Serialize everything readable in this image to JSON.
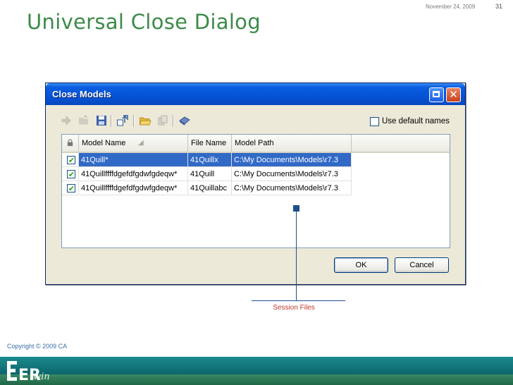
{
  "slide": {
    "date": "November 24, 2009",
    "page_number": "31",
    "title": "Universal Close Dialog",
    "copyright": "Copyright © 2009 CA",
    "logo_text": "ER",
    "logo_script": "win"
  },
  "dialog": {
    "title": "Close Models",
    "use_default_names_label": "Use default names",
    "use_default_names_checked": false,
    "toolbar_icons": [
      "arrow-right-icon",
      "open-folder-disabled-icon",
      "save-icon",
      "swap-models-icon",
      "open-folder-icon",
      "copy-icon",
      "model-icon"
    ],
    "columns": [
      "Model Name",
      "File Name",
      "Model Path"
    ],
    "rows": [
      {
        "model_name": "41Quill*",
        "file_name": "41Quillx",
        "model_path": "C:\\My Documents\\Models\\r7.3",
        "checked": true,
        "selected": true
      },
      {
        "model_name": "41Quillffffdgefdfgdwfgdeqw*",
        "file_name": "41Quill",
        "model_path": "C:\\My Documents\\Models\\r7.3",
        "checked": true,
        "selected": false
      },
      {
        "model_name": "41Quillffffdgefdfgdwfgdeqw*",
        "file_name": "41Quillabc",
        "model_path": "C:\\My Documents\\Models\\r7.3",
        "checked": true,
        "selected": false
      }
    ],
    "ok_label": "OK",
    "cancel_label": "Cancel"
  },
  "callout": {
    "label": "Session Files",
    "color": "#1f4e8c"
  },
  "colors": {
    "title_green": "#3d8a4a",
    "selection_blue": "#3169c6",
    "titlebar_blue": "#0553d6"
  }
}
